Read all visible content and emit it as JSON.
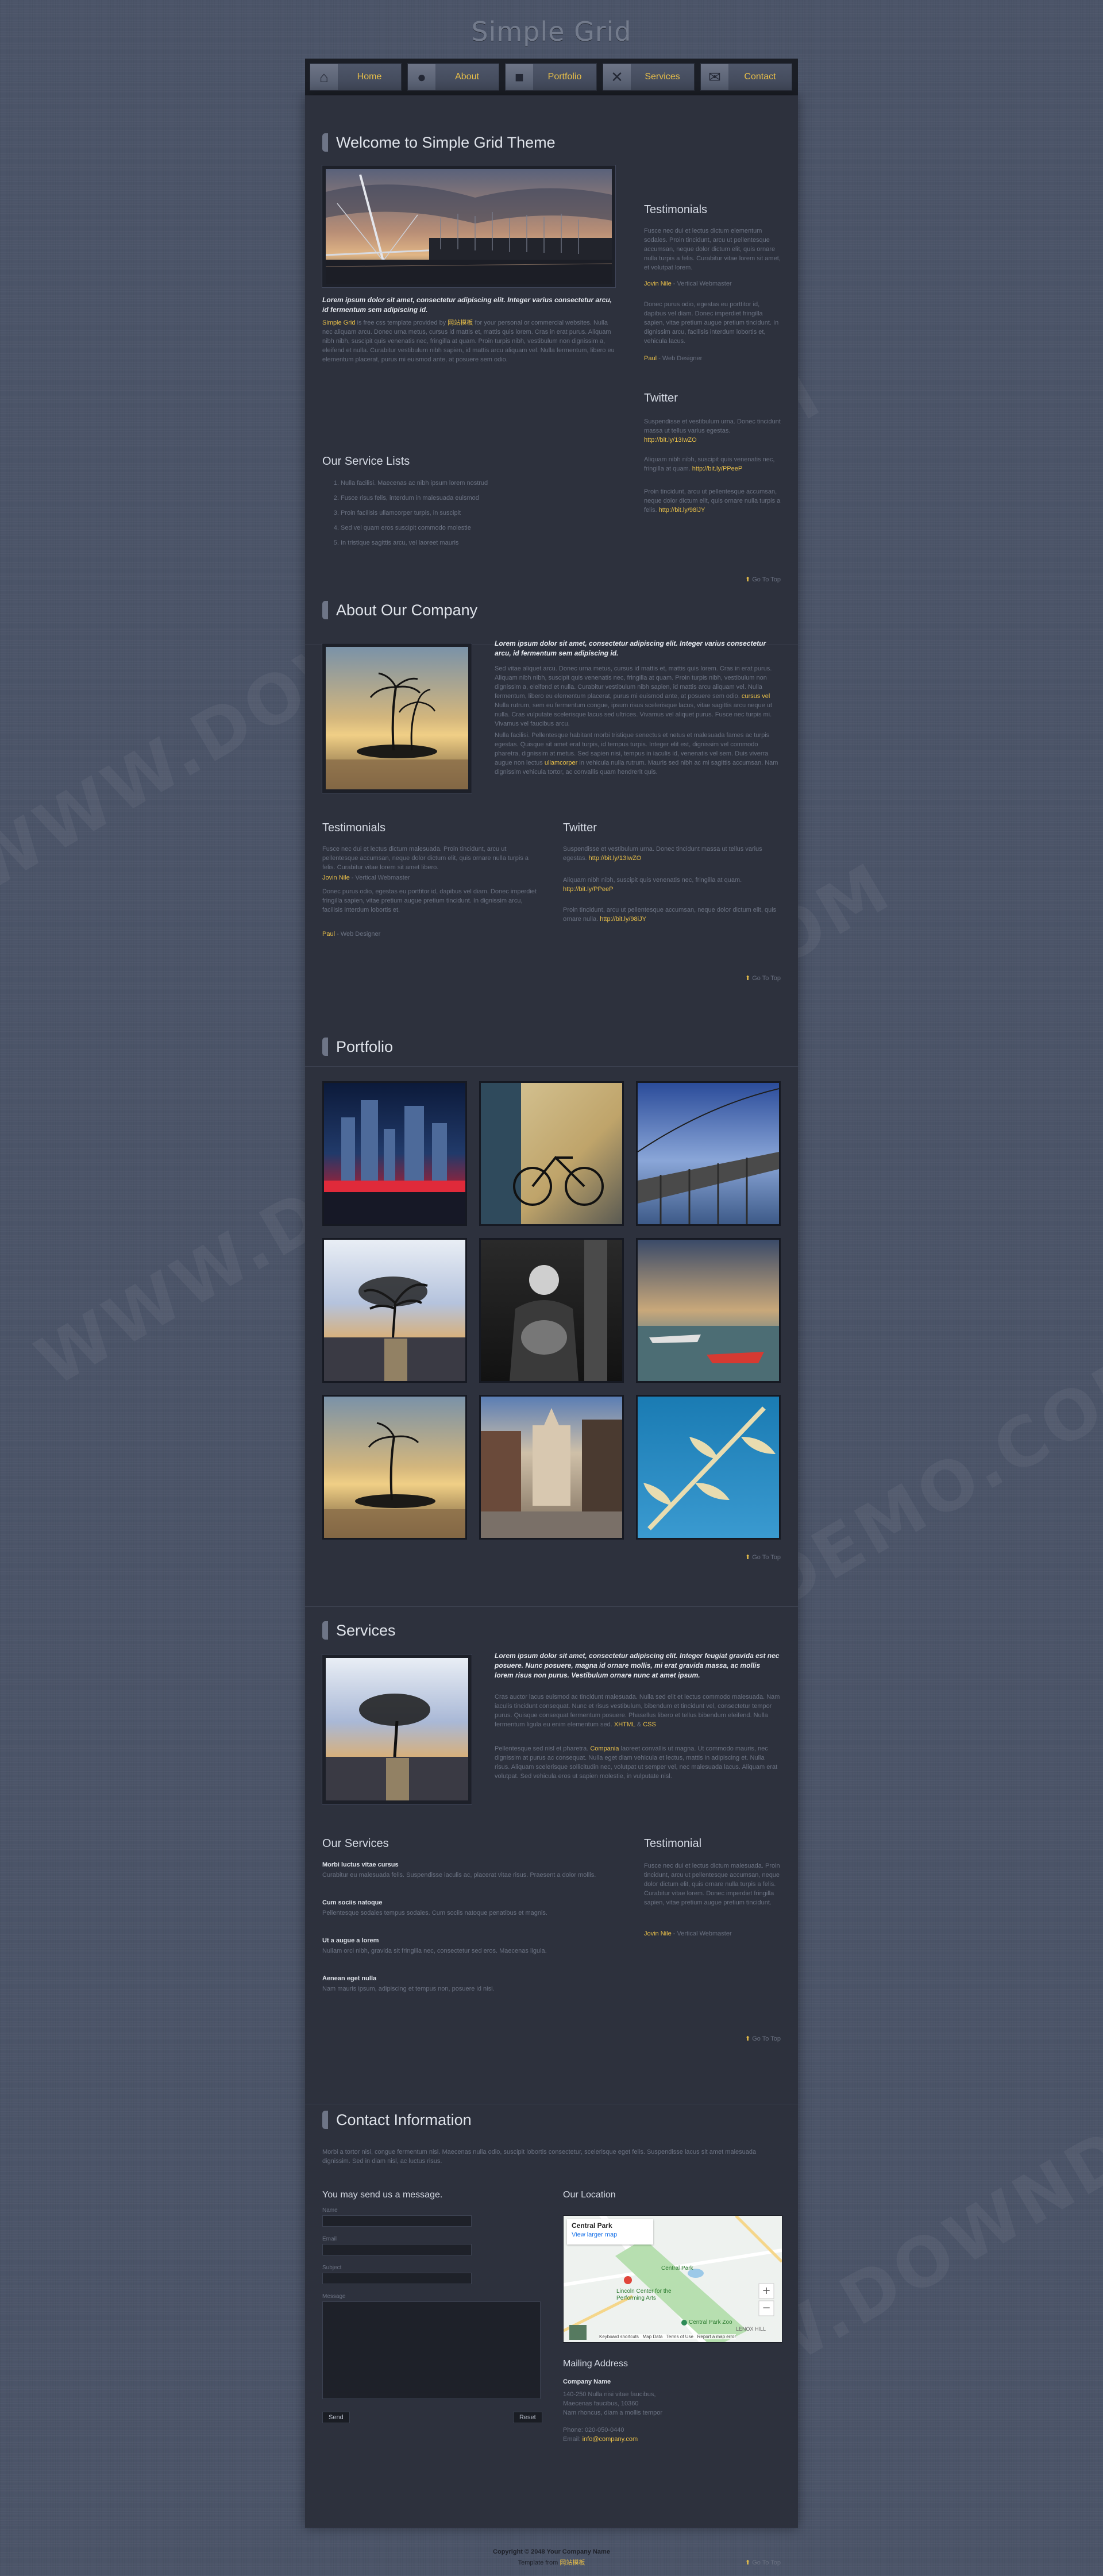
{
  "site": {
    "title": "Simple Grid"
  },
  "nav": [
    {
      "label": "Home",
      "icon": "home-icon"
    },
    {
      "label": "About",
      "icon": "user-icon"
    },
    {
      "label": "Portfolio",
      "icon": "briefcase-icon"
    },
    {
      "label": "Services",
      "icon": "tools-icon"
    },
    {
      "label": "Contact",
      "icon": "envelope-icon"
    }
  ],
  "home": {
    "title": "Welcome to Simple Grid Theme",
    "lead": "Lorem ipsum dolor sit amet, consectetur adipiscing elit. Integer varius consectetur arcu, id fermentum sem adipiscing id.",
    "body_link": "Simple Grid",
    "body_text": "is free css template provided by",
    "body_link2": "网站模板",
    "body_rest": "for your personal or commercial websites. Nulla nec aliquam arcu. Donec urna metus, cursus id mattis et, mattis quis lorem. Cras in erat purus. Aliquam nibh nibh, suscipit quis venenatis nec, fringilla at quam. Proin turpis nibh, vestibulum non dignissim a, eleifend et nulla. Curabitur vestibulum nibh sapien, id mattis arcu aliquam vel. Nulla fermentum, libero eu elementum placerat, purus mi euismod ante, at posuere sem odio.",
    "services_title": "Our Service Lists",
    "services": [
      "Nulla facilisi. Maecenas ac nibh ipsum lorem nostrud",
      "Fusce risus felis, interdum in malesuada euismod",
      "Proin facilisis ullamcorper turpis, in suscipit",
      "Sed vel quam eros suscipit commodo molestie",
      "In tristique sagittis arcu, vel laoreet mauris"
    ],
    "testimonials_title": "Testimonials",
    "testimonial1_text": "Fusce nec dui et lectus dictum elementum sodales. Proin tincidunt, arcu ut pellentesque accumsan, neque dolor dictum elit, quis ornare nulla turpis a felis. Curabitur vitae lorem sit amet, et volutpat lorem.",
    "testimonial1_name": "Jovin Nile",
    "testimonial1_role": "- Vertical Webmaster",
    "testimonial2_text": "Donec purus odio, egestas eu porttitor id, dapibus vel diam. Donec imperdiet fringilla sapien, vitae pretium augue pretium tincidunt. In dignissim arcu, facilisis interdum lobortis et, vehicula lacus.",
    "testimonial2_name": "Paul",
    "testimonial2_role": "- Web Designer",
    "twitter_title": "Twitter",
    "tweet1_text": "Suspendisse et vestibulum urna. Donec tincidunt massa ut tellus varius egestas.",
    "tweet1_link": "http://bit.ly/13IwZO",
    "tweet2_text": "Aliquam nibh nibh, suscipit quis venenatis nec, fringilla at quam.",
    "tweet2_link": "http://bit.ly/PPeeP",
    "tweet3_text": "Proin tincidunt, arcu ut pellentesque accumsan, neque dolor dictum elit, quis ornare nulla turpis a felis.",
    "tweet3_link": "http://bit.ly/98iJY",
    "go_top": "Go To Top"
  },
  "about": {
    "title": "About Our Company",
    "lead": "Lorem ipsum dolor sit amet, consectetur adipiscing elit. Integer varius consectetur arcu, id fermentum sem adipiscing id.",
    "p1": "Sed vitae aliquet arcu. Donec urna metus, cursus id mattis et, mattis quis lorem. Cras in erat purus. Aliquam nibh nibh, suscipit quis venenatis nec, fringilla at quam. Proin turpis nibh, vestibulum non dignissim a, eleifend et nulla. Curabitur vestibulum nibh sapien, id mattis arcu aliquam vel. Nulla fermentum, libero eu elementum placerat, purus mi euismod ante, at posuere sem odio.",
    "p1_link": "cursus vel",
    "p1_rest": "Nulla rutrum, sem eu fermentum congue, ipsum risus scelerisque lacus, vitae sagittis arcu neque ut nulla. Cras vulputate scelerisque lacus sed ultrices. Vivamus vel aliquet purus. Fusce nec turpis mi. Vivamus vel faucibus arcu.",
    "p2": "Nulla facilisi. Pellentesque habitant morbi tristique senectus et netus et malesuada fames ac turpis egestas. Quisque sit amet erat turpis, id tempus turpis. Integer elit est, dignissim vel commodo pharetra, dignissim at metus. Sed sapien nisi, tempus in iaculis id, venenatis vel sem. Duis viverra augue non lectus",
    "p2_link": "ullamcorper",
    "p2_rest": "in vehicula nulla rutrum. Mauris sed nibh ac mi sagittis accumsan. Nam dignissim vehicula tortor, ac convallis quam hendrerit quis.",
    "testimonials_title": "Testimonials",
    "t1_text": "Fusce nec dui et lectus dictum malesuada. Proin tincidunt, arcu ut pellentesque accumsan, neque dolor dictum elit, quis ornare nulla turpis a felis. Curabitur vitae lorem sit amet libero.",
    "t1_name": "Jovin Nile",
    "t1_role": "- Vertical Webmaster",
    "t2_text": "Donec purus odio, egestas eu porttitor id, dapibus vel diam. Donec imperdiet fringilla sapien, vitae pretium augue pretium tincidunt. In dignissim arcu, facilisis interdum lobortis et.",
    "t2_name": "Paul",
    "t2_role": "- Web Designer",
    "twitter_title": "Twitter",
    "tweet1_text": "Suspendisse et vestibulum urna. Donec tincidunt massa ut tellus varius egestas.",
    "tweet1_link": "http://bit.ly/13IwZO",
    "tweet2_text": "Aliquam nibh nibh, suscipit quis venenatis nec, fringilla at quam.",
    "tweet2_link": "http://bit.ly/PPeeP",
    "tweet3_text": "Proin tincidunt, arcu ut pellentesque accumsan, neque dolor dictum elit, quis ornare nulla.",
    "tweet3_link": "http://bit.ly/98iJY",
    "go_top": "Go To Top"
  },
  "portfolio": {
    "title": "Portfolio",
    "go_top": "Go To Top"
  },
  "services": {
    "title": "Services",
    "lead": "Lorem ipsum dolor sit amet, consectetur adipiscing elit. Integer feugiat gravida est nec posuere. Nunc posuere, magna id ornare mollis, mi erat gravida massa, ac mollis lorem risus non purus. Vestibulum ornare nunc at amet ipsum.",
    "p1": "Cras auctor lacus euismod ac tincidunt malesuada. Nulla sed elit et lectus commodo malesuada. Nam iaculis tincidunt consequat. Nunc et risus vestibulum, bibendum et tincidunt vel, consectetur tempor purus. Quisque consequat fermentum posuere. Phasellus libero et tellus bibendum eleifend. Nulla fermentum ligula eu enim elementum sed.",
    "p1_tail": "XHTML",
    "p1_amp": "&",
    "p1_tail2": "CSS",
    "p2": "Pellentesque sed nisl et pharetra.",
    "p2_link": "Compania",
    "p2_rest": "laoreet convallis ut magna. Ut commodo mauris, nec dignissim at purus ac consequat. Nulla eget diam vehicula et lectus, mattis in adipiscing et. Nulla risus. Aliquam scelerisque sollicitudin nec, volutpat ut semper vel, nec malesuada lacus. Aliquam erat volutpat. Sed vehicula eros ut sapien molestie, in vulputate nisl.",
    "our_services_title": "Our Services",
    "items": [
      {
        "title": "Morbi luctus vitae cursus",
        "text": "Curabitur eu malesuada felis. Suspendisse iaculis ac, placerat vitae risus. Praesent a dolor mollis."
      },
      {
        "title": "Cum sociis natoque",
        "text": "Pellentesque sodales tempus sodales. Cum sociis natoque penatibus et magnis."
      },
      {
        "title": "Ut a augue a lorem",
        "text": "Nullam orci nibh, gravida sit fringilla nec, consectetur sed eros. Maecenas ligula."
      },
      {
        "title": "Aenean eget nulla",
        "text": "Nam mauris ipsum, adipiscing et tempus non, posuere id nisi."
      }
    ],
    "testimonial_title": "Testimonial",
    "t_text": "Fusce nec dui et lectus dictum malesuada. Proin tincidunt, arcu ut pellentesque accumsan, neque dolor dictum elit, quis ornare nulla turpis a felis. Curabitur vitae lorem. Donec imperdiet fringilla sapien, vitae pretium augue pretium tincidunt.",
    "t_name": "Jovin Nile",
    "t_role": "- Vertical Webmaster",
    "go_top": "Go To Top"
  },
  "contact": {
    "title": "Contact Information",
    "intro": "Morbi a tortor nisi, congue fermentum nisi. Maecenas nulla odio, suscipit lobortis consectetur, scelerisque eget felis. Suspendisse lacus sit amet malesuada dignissim. Sed in diam nisl, ac luctus risus.",
    "form_title": "You may send us a message.",
    "name_label": "Name",
    "email_label": "Email",
    "subject_label": "Subject",
    "message_label": "Message",
    "send_label": "Send",
    "reset_label": "Reset",
    "location_title": "Our Location",
    "map_place": "Central Park",
    "map_link": "View larger map",
    "map_label_park": "Central Park",
    "map_label_lincoln": "Lincoln Center for the Performing Arts",
    "map_label_zoo": "Central Park Zoo",
    "map_label_lenox": "LENOX HILL",
    "map_footer": "Keyboard shortcuts   Map Data   Terms of Use   Report a map error",
    "mailing_title": "Mailing Address",
    "company": "Company Name",
    "addr1": "140-250 Nulla nisi vitae faucibus,",
    "addr2": "Maecenas faucibus, 10360",
    "addr3": "Nam rhoncus, diam a mollis tempor",
    "phone_label": "Phone:",
    "phone": "020-050-0440",
    "email_label2": "Email:",
    "email": "info@company.com",
    "go_top": "Go To Top"
  },
  "footer": {
    "copyright": "Copyright © 2048 Your Company Name",
    "template_from": "Template from",
    "template_link": "网站模板"
  },
  "watermark": "WWW.DOWNDEMO.COM",
  "colors": {
    "gold": "#e8bf49",
    "page_bg": "#4b5468",
    "panel": "#2d313d"
  }
}
